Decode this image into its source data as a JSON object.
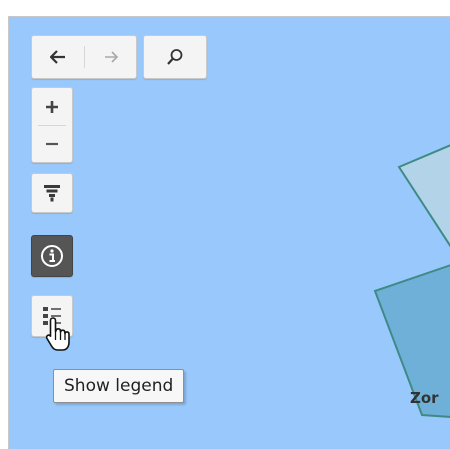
{
  "map": {
    "background_color": "#99c9fc",
    "zone_label": "Zor",
    "polygon_colors": {
      "light_zone_fill": "#b3d4e8",
      "dark_zone_fill": "#6fb0d8",
      "zone_stroke": "#3f8a86"
    }
  },
  "toolbar": {
    "back_icon": "arrow-left-icon",
    "forward_icon": "arrow-right-icon",
    "search_icon": "magnifier-icon",
    "zoom_in_icon": "plus-icon",
    "zoom_out_icon": "minus-icon",
    "filter_icon": "funnel-icon",
    "info_icon": "info-circle-icon",
    "legend_icon": "legend-list-icon",
    "info_active_color": "#555555"
  },
  "tooltip": {
    "text": "Show legend"
  },
  "cursor": {
    "icon": "hand-pointer-icon"
  }
}
